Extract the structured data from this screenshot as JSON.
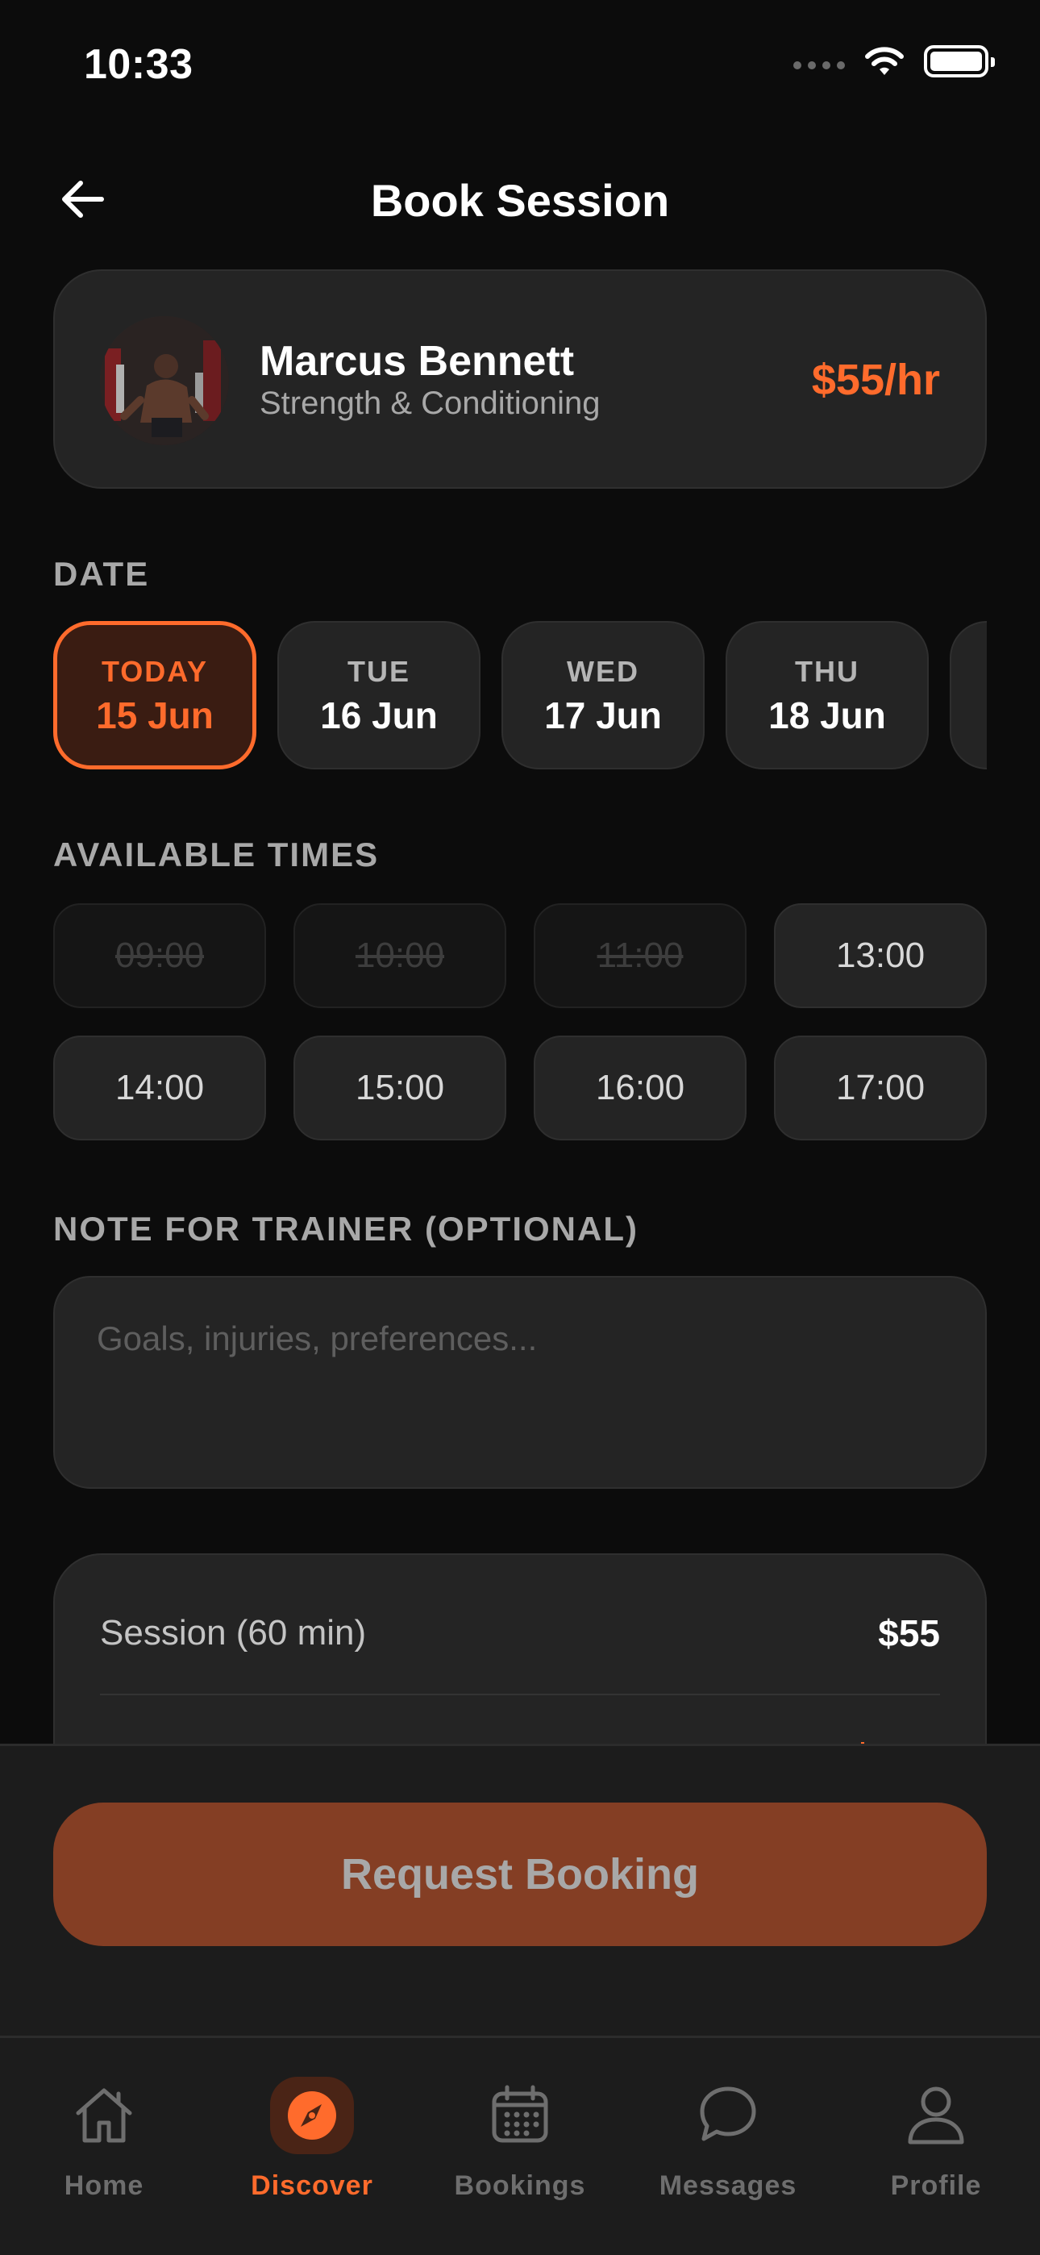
{
  "status_bar": {
    "time": "10:33"
  },
  "header": {
    "title": "Book Session"
  },
  "trainer": {
    "name": "Marcus Bennett",
    "specialty": "Strength & Conditioning",
    "rate": "$55/hr"
  },
  "date_section": {
    "label": "DATE",
    "dates": [
      {
        "dow": "TODAY",
        "day": "15 Jun",
        "selected": true
      },
      {
        "dow": "TUE",
        "day": "16 Jun",
        "selected": false
      },
      {
        "dow": "WED",
        "day": "17 Jun",
        "selected": false
      },
      {
        "dow": "THU",
        "day": "18 Jun",
        "selected": false
      },
      {
        "dow": "",
        "day": "",
        "selected": false
      }
    ]
  },
  "times_section": {
    "label": "AVAILABLE TIMES",
    "slots": [
      {
        "time": "09:00",
        "available": false
      },
      {
        "time": "10:00",
        "available": false
      },
      {
        "time": "11:00",
        "available": false
      },
      {
        "time": "13:00",
        "available": true
      },
      {
        "time": "14:00",
        "available": true
      },
      {
        "time": "15:00",
        "available": true
      },
      {
        "time": "16:00",
        "available": true
      },
      {
        "time": "17:00",
        "available": true
      }
    ]
  },
  "note_section": {
    "label": "NOTE FOR TRAINER (OPTIONAL)",
    "placeholder": "Goals, injuries, preferences...",
    "value": ""
  },
  "summary": {
    "session_label": "Session (60 min)",
    "session_price": "$55"
  },
  "action": {
    "request_label": "Request Booking"
  },
  "tab_bar": {
    "tabs": [
      {
        "label": "Home",
        "icon": "home-icon",
        "active": false
      },
      {
        "label": "Discover",
        "icon": "compass-icon",
        "active": true
      },
      {
        "label": "Bookings",
        "icon": "calendar-icon",
        "active": false
      },
      {
        "label": "Messages",
        "icon": "chat-bubble-icon",
        "active": false
      },
      {
        "label": "Profile",
        "icon": "person-icon",
        "active": false
      }
    ]
  },
  "colors": {
    "accent": "#ff6b2c",
    "background": "#0c0c0c",
    "card": "#242424",
    "button_disabled": "#843e24"
  }
}
